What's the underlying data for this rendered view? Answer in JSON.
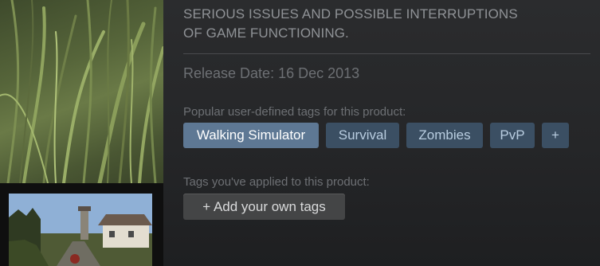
{
  "notice": {
    "line1": "SERIOUS ISSUES AND POSSIBLE INTERRUPTIONS",
    "line2": "OF GAME FUNCTIONING."
  },
  "release": "Release Date: 16 Dec 2013",
  "popular_tags": {
    "label": "Popular user-defined tags for this product:",
    "tags": [
      "Walking Simulator",
      "Survival",
      "Zombies",
      "PvP"
    ],
    "more_label": "+"
  },
  "user_tags": {
    "label": "Tags you've applied to this product:",
    "add_label": "+ Add your own tags"
  }
}
